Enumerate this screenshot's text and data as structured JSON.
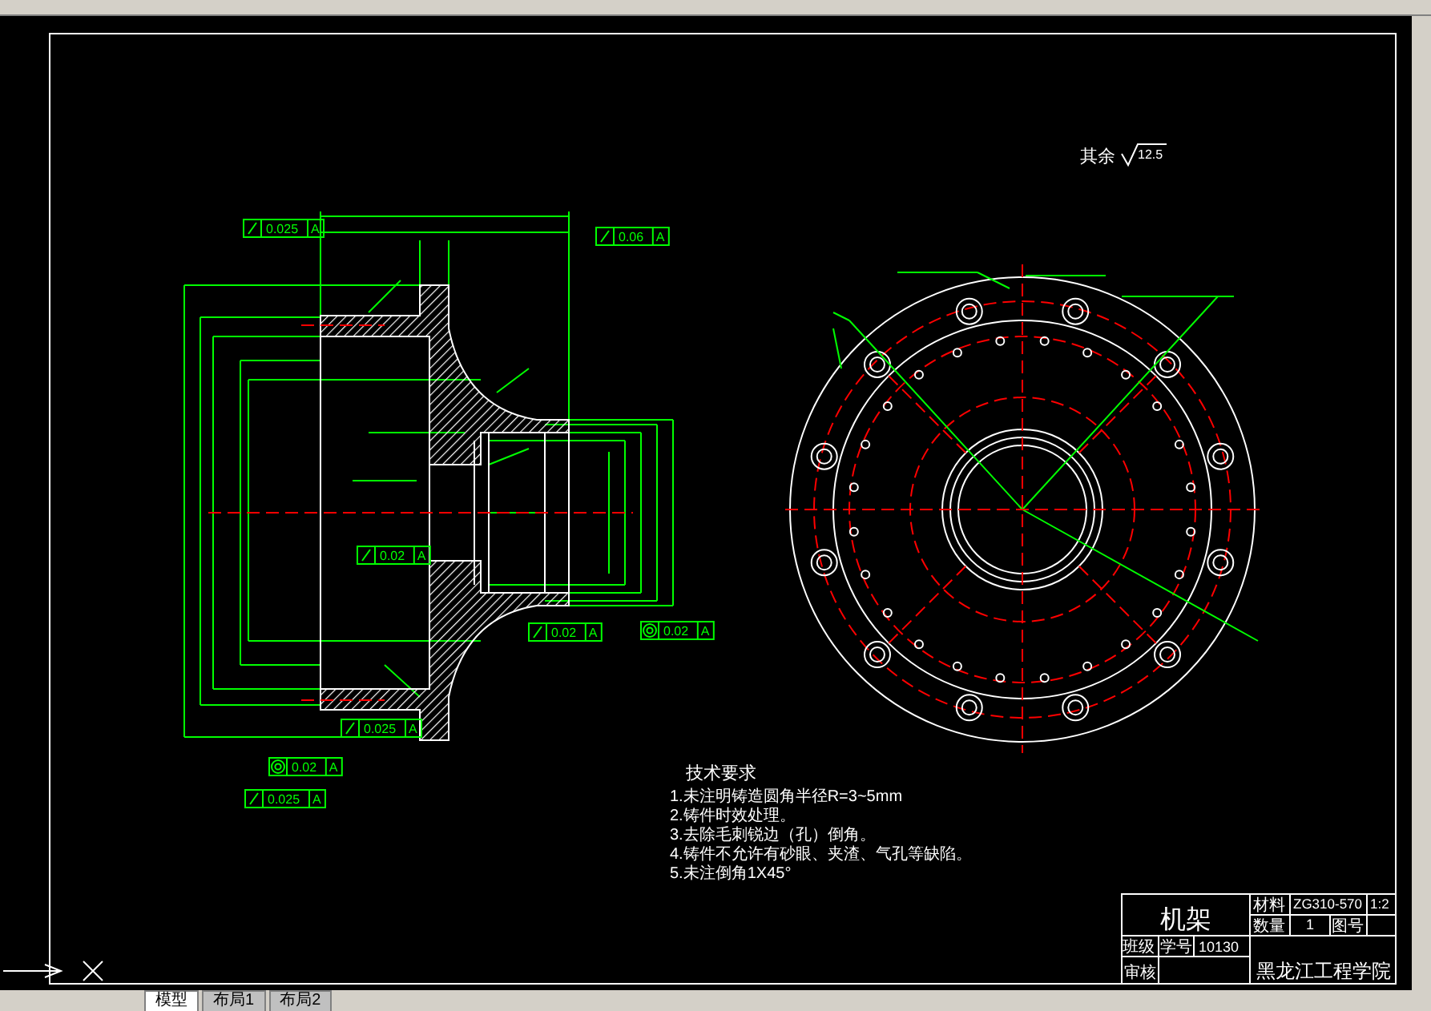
{
  "surface_note": {
    "label": "其余",
    "roughness": "12.5"
  },
  "tolerance_frames": [
    {
      "kind": "runout",
      "value": "0.025",
      "datum": "A"
    },
    {
      "kind": "runout",
      "value": "0.06",
      "datum": "A"
    },
    {
      "kind": "runout",
      "value": "0.02",
      "datum": "A"
    },
    {
      "kind": "runout",
      "value": "0.02",
      "datum": "A"
    },
    {
      "kind": "concentricity",
      "value": "0.02",
      "datum": "A"
    },
    {
      "kind": "runout",
      "value": "0.025",
      "datum": "A"
    },
    {
      "kind": "concentricity",
      "value": "0.02",
      "datum": "A"
    },
    {
      "kind": "runout",
      "value": "0.025",
      "datum": "A"
    }
  ],
  "technical_requirements": {
    "title": "技术要求",
    "items": [
      "1.未注明铸造圆角半径R=3~5mm",
      "2.铸件时效处理。",
      "3.去除毛刺锐边（孔）倒角。",
      "4.铸件不允许有砂眼、夹渣、气孔等缺陷。",
      "5.未注倒角1X45°"
    ]
  },
  "title_block": {
    "part_name": "机架",
    "material_label": "材料",
    "material": "ZG310-570",
    "scale": "1:2",
    "quantity_label": "数量",
    "quantity": "1",
    "drawing_no_label": "图号",
    "class_label": "班级",
    "student_no_label": "学号",
    "student_no": "10130",
    "reviewer_label": "审核",
    "school": "黑龙江工程学院"
  },
  "layout_tabs": [
    {
      "label": "模型",
      "selected": true
    },
    {
      "label": "布局1",
      "selected": false
    },
    {
      "label": "布局2",
      "selected": false
    }
  ]
}
